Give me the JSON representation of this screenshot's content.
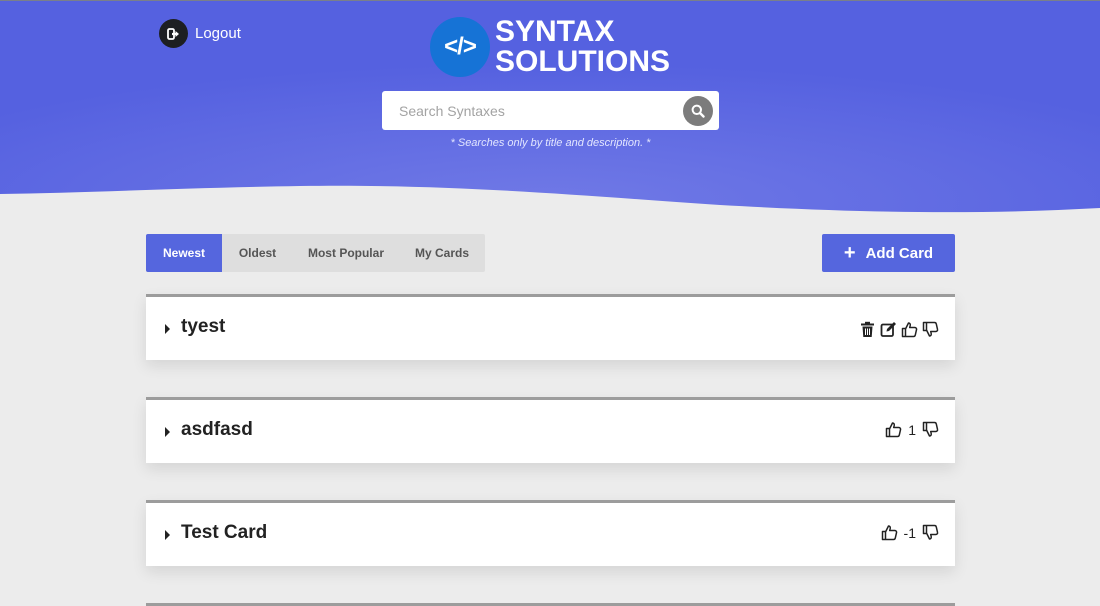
{
  "header": {
    "logout_label": "Logout",
    "brand_logo_text": "</>",
    "brand_line1": "Syntax",
    "brand_line2": "Solutions",
    "search_placeholder": "Search Syntaxes",
    "search_hint": "* Searches only by title and description. *"
  },
  "colors": {
    "hero_gradient_start": "#5561e0",
    "hero_gradient_center": "#7079e6",
    "accent": "#5566de",
    "logo_blue": "#1673d6",
    "page_bg": "#ececec"
  },
  "sort_tabs": [
    {
      "label": "Newest",
      "active": true
    },
    {
      "label": "Oldest",
      "active": false
    },
    {
      "label": "Most Popular",
      "active": false
    },
    {
      "label": "My Cards",
      "active": false
    }
  ],
  "add_card_label": "Add Card",
  "cards": [
    {
      "title": "tyest",
      "own_card": true,
      "votes": ""
    },
    {
      "title": "asdfasd",
      "own_card": false,
      "votes": "1"
    },
    {
      "title": "Test Card",
      "own_card": false,
      "votes": "-1"
    }
  ],
  "icons": [
    "logout-icon",
    "search-icon",
    "plus-icon",
    "caret-right-icon",
    "trash-icon",
    "edit-icon",
    "thumbs-up-icon",
    "thumbs-down-icon"
  ]
}
